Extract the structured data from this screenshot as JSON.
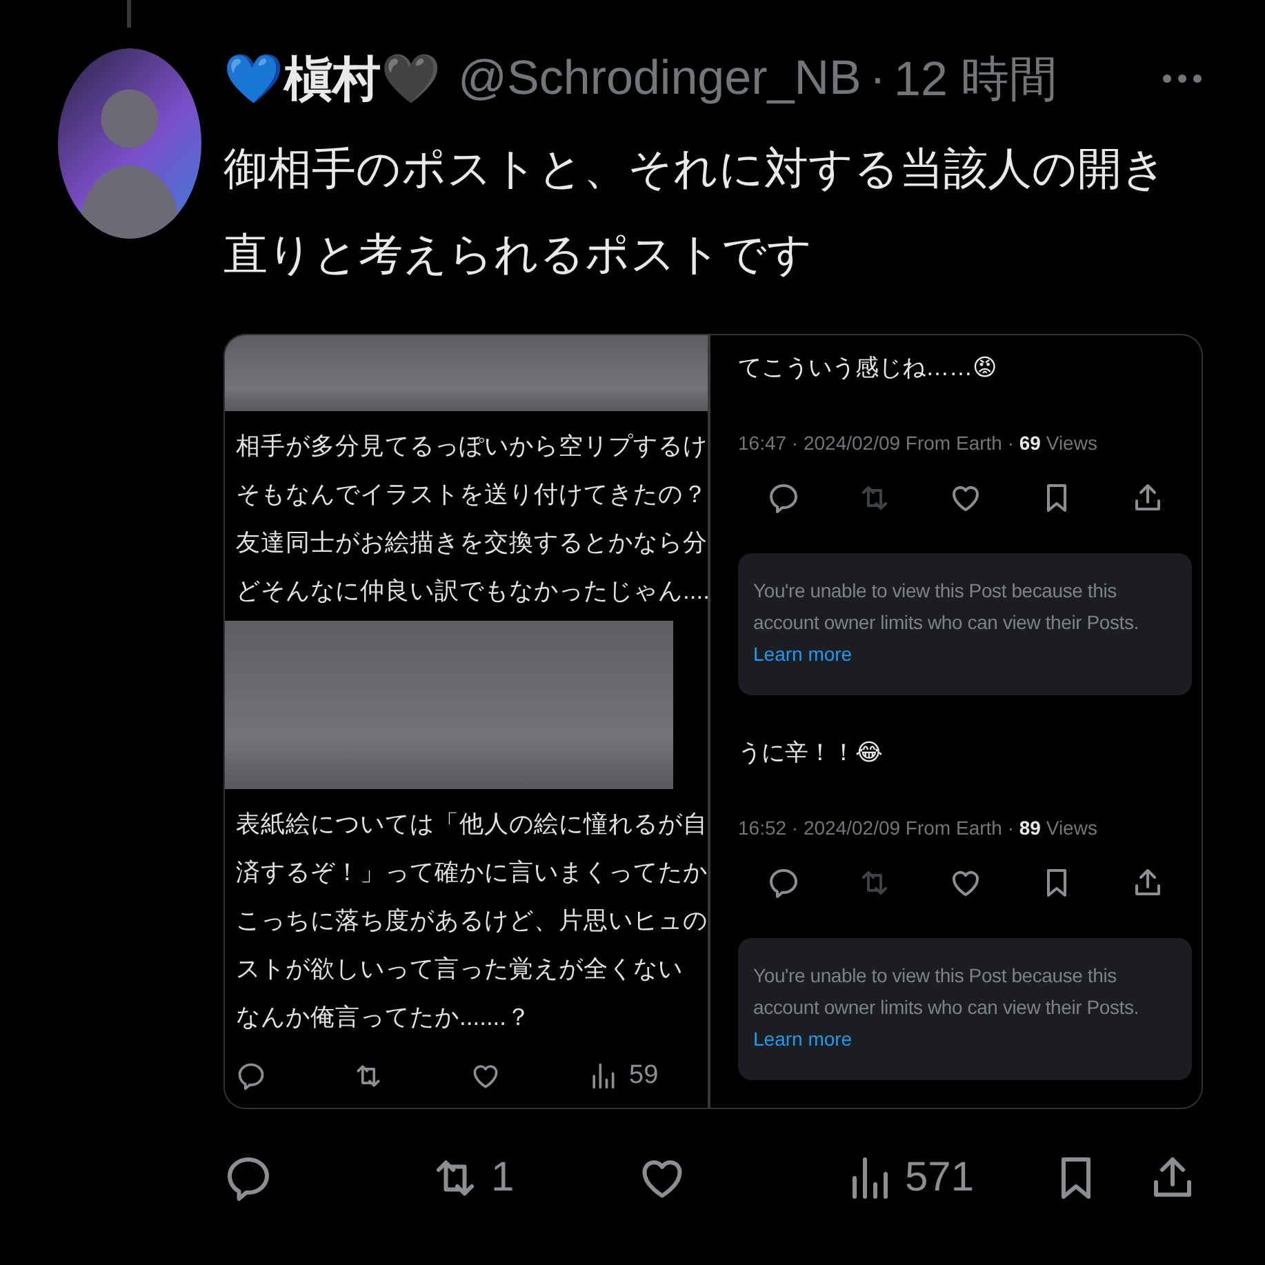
{
  "post": {
    "author": {
      "display_name": "💙槇村🖤",
      "handle": "@Schrodinger_NB",
      "separator": "·",
      "time": "12 時間"
    },
    "text": "御相手のポストと、それに対する当該人の開き直りと考えられるポストです",
    "media": {
      "left_screenshot": {
        "blocks": [
          {
            "kind": "blur"
          },
          {
            "kind": "text",
            "lines": [
              "相手が多分見てるっぽいから空リプするけ",
              "そもなんでイラストを送り付けてきたの？",
              "友達同士がお絵描きを交換するとかなら分",
              "どそんなに仲良い訳でもなかったじゃん...."
            ]
          },
          {
            "kind": "blur"
          },
          {
            "kind": "text",
            "lines": [
              "表紙絵については「他人の絵に憧れるが自",
              "済するぞ！」って確かに言いまくってたか",
              "こっちに落ち度があるけど、片思いヒュの",
              "ストが欲しいって言った覚えが全くない",
              "なんか俺言ってたか.......？"
            ]
          }
        ],
        "actions": [
          {
            "kind": "reply"
          },
          {
            "kind": "retweet"
          },
          {
            "kind": "like"
          },
          {
            "kind": "views",
            "count": "59"
          }
        ]
      },
      "right_screenshot": {
        "items": [
          {
            "kind": "post",
            "text": "てこういう感じね……😡",
            "meta": "16:47 · 2024/02/09 From Earth · **69** Views",
            "actions": [
              {
                "kind": "reply",
                "disabled": false
              },
              {
                "kind": "retweet",
                "disabled": true
              },
              {
                "kind": "like",
                "disabled": false
              },
              {
                "kind": "bookmark",
                "disabled": false
              },
              {
                "kind": "share",
                "disabled": false
              }
            ]
          },
          {
            "kind": "notice",
            "text": "You're unable to view this Post because this account owner limits who can view their Posts.",
            "link": "Learn more"
          },
          {
            "kind": "post",
            "text": "うに辛！！😂",
            "meta": "16:52 · 2024/02/09 From Earth · **89** Views",
            "actions": [
              {
                "kind": "reply",
                "disabled": false
              },
              {
                "kind": "retweet",
                "disabled": true
              },
              {
                "kind": "like",
                "disabled": false
              },
              {
                "kind": "bookmark",
                "disabled": false
              },
              {
                "kind": "share",
                "disabled": false
              }
            ]
          },
          {
            "kind": "notice",
            "text": "You're unable to view this Post because this account owner limits who can view their Posts.",
            "link": "Learn more"
          }
        ]
      }
    },
    "actions": [
      {
        "kind": "reply"
      },
      {
        "kind": "retweet",
        "count": "1"
      },
      {
        "kind": "like"
      },
      {
        "kind": "views",
        "count": "571"
      },
      {
        "kind": "bookmark"
      },
      {
        "kind": "share"
      }
    ]
  }
}
